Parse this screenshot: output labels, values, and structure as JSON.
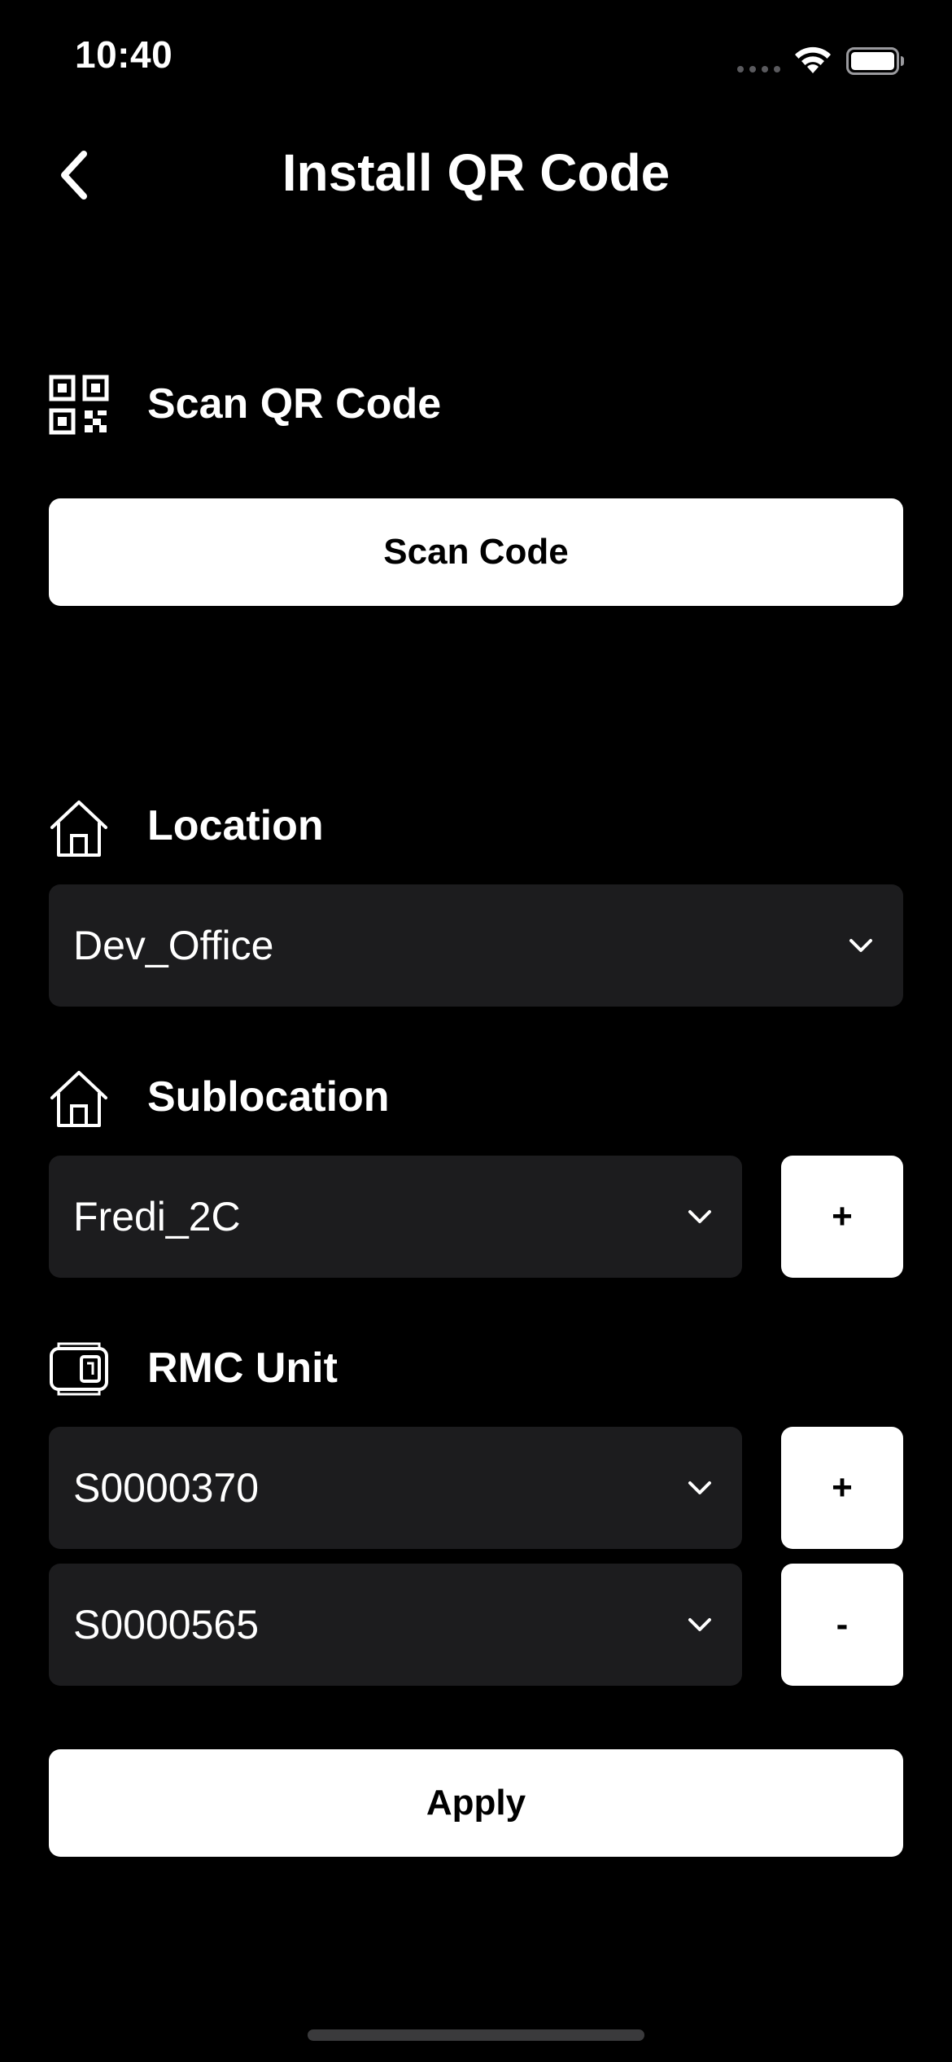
{
  "status_bar": {
    "time": "10:40"
  },
  "nav": {
    "title": "Install QR Code"
  },
  "scan": {
    "label": "Scan QR Code",
    "button": "Scan Code"
  },
  "location": {
    "label": "Location",
    "value": "Dev_Office"
  },
  "sublocation": {
    "label": "Sublocation",
    "value": "Fredi_2C",
    "add": "+"
  },
  "rmc": {
    "label": "RMC Unit",
    "units": [
      {
        "value": "S0000370",
        "action": "+"
      },
      {
        "value": "S0000565",
        "action": "-"
      }
    ]
  },
  "apply": {
    "label": "Apply"
  }
}
